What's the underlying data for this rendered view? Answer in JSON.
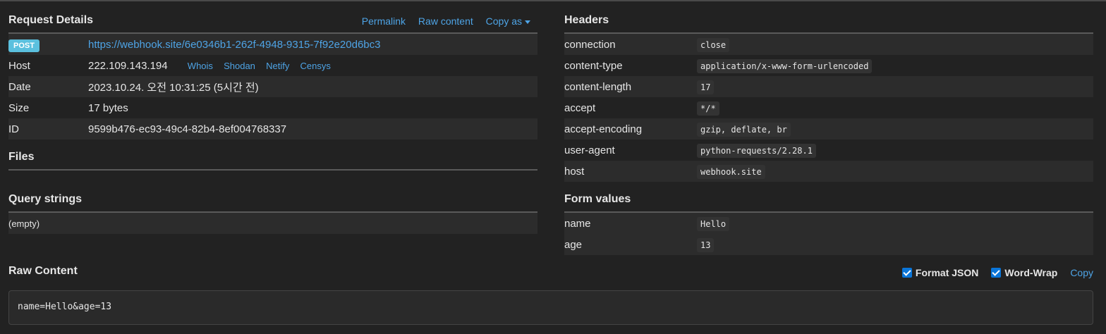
{
  "request": {
    "title": "Request Details",
    "links": [
      "Permalink",
      "Raw content",
      "Copy as"
    ],
    "method": "POST",
    "url": "https://webhook.site/6e0346b1-262f-4948-9315-7f92e20d6bc3",
    "host_label": "Host",
    "host": "222.109.143.194",
    "host_links": [
      "Whois",
      "Shodan",
      "Netify",
      "Censys"
    ],
    "date_label": "Date",
    "date": "2023.10.24. 오전 10:31:25 (5시간 전)",
    "size_label": "Size",
    "size": "17 bytes",
    "id_label": "ID",
    "id": "9599b476-ec93-49c4-82b4-8ef004768337"
  },
  "files": {
    "title": "Files"
  },
  "query": {
    "title": "Query strings",
    "empty": "(empty)"
  },
  "headers": {
    "title": "Headers",
    "items": [
      {
        "key": "connection",
        "value": "close"
      },
      {
        "key": "content-type",
        "value": "application/x-www-form-urlencoded"
      },
      {
        "key": "content-length",
        "value": "17"
      },
      {
        "key": "accept",
        "value": "*/*"
      },
      {
        "key": "accept-encoding",
        "value": "gzip, deflate, br"
      },
      {
        "key": "user-agent",
        "value": "python-requests/2.28.1"
      },
      {
        "key": "host",
        "value": "webhook.site"
      }
    ]
  },
  "form": {
    "title": "Form values",
    "items": [
      {
        "key": "name",
        "value": "Hello"
      },
      {
        "key": "age",
        "value": "13"
      }
    ]
  },
  "raw": {
    "title": "Raw Content",
    "format_json": "Format JSON",
    "word_wrap": "Word-Wrap",
    "copy": "Copy",
    "content": "name=Hello&age=13"
  }
}
